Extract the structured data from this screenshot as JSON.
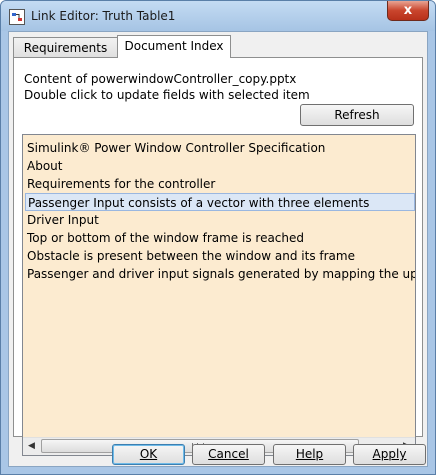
{
  "window": {
    "title": "Link Editor: Truth Table1",
    "icon": "simulink-link-icon",
    "close_label": "x"
  },
  "tabs": [
    {
      "label": "Requirements",
      "selected": false
    },
    {
      "label": "Document Index",
      "selected": true
    }
  ],
  "panel": {
    "content_line": "Content of powerwindowController_copy.pptx",
    "hint_line": "Double click to update fields with selected item",
    "refresh_label": "Refresh",
    "list_items": [
      {
        "label": "Simulink® Power Window Controller Specification",
        "selected": false
      },
      {
        "label": "About",
        "selected": false
      },
      {
        "label": "Requirements for the controller",
        "selected": false
      },
      {
        "label": "Passenger Input  consists of a vector with three elements",
        "selected": true
      },
      {
        "label": "Driver Input",
        "selected": false
      },
      {
        "label": "Top or bottom of the window frame is reached",
        "selected": false
      },
      {
        "label": "Obstacle is present between the window and its frame",
        "selected": false
      },
      {
        "label": "Passenger and driver input signals generated by mapping the up ar",
        "selected": false
      }
    ],
    "list_background": "#fcebd0",
    "selection_color": "#dbe7f6"
  },
  "buttons": {
    "ok": "OK",
    "cancel": "Cancel",
    "help": "Help",
    "apply": "Apply"
  }
}
